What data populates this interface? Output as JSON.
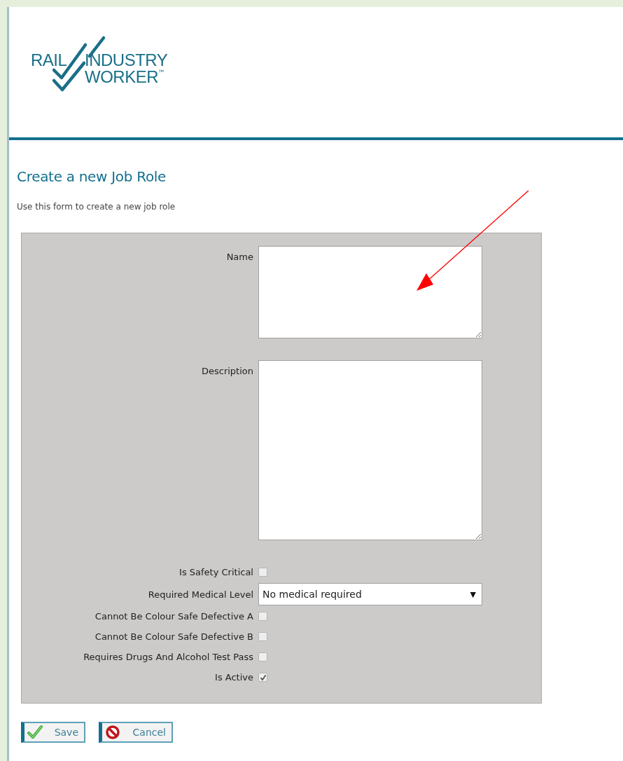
{
  "logo": {
    "word_1": "RAIL",
    "word_2": "INDUSTRY",
    "word_3": "WORKER",
    "trademark": "™"
  },
  "page": {
    "title": "Create a new Job Role",
    "subtitle": "Use this form to create a new job role"
  },
  "fields": [
    {
      "kind": "shorttext",
      "label": "Name"
    },
    {
      "kind": "longtext",
      "label": "Description"
    },
    {
      "kind": "checkbox",
      "label": "Is Safety Critical",
      "checked": false
    },
    {
      "kind": "select",
      "label": "Required Medical Level",
      "value": "No medical required",
      "caret": "▼"
    },
    {
      "kind": "checkbox",
      "label": "Cannot Be Colour Safe Defective A",
      "checked": false
    },
    {
      "kind": "checkbox",
      "label": "Cannot Be Colour Safe Defective B",
      "checked": false
    },
    {
      "kind": "checkbox",
      "label": "Requires Drugs And Alcohol Test Pass",
      "checked": false
    },
    {
      "kind": "checkbox",
      "label": "Is Active",
      "checked": true
    }
  ],
  "buttons": [
    {
      "kind": "save",
      "label": "Save"
    },
    {
      "kind": "cancel",
      "label": "Cancel"
    }
  ]
}
